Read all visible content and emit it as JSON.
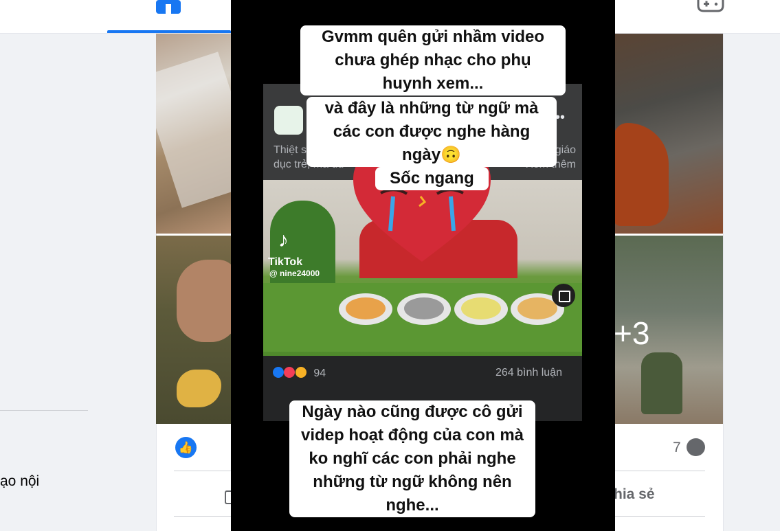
{
  "nav": {
    "active_tab": "home",
    "icons": {
      "home": "home-icon",
      "gaming": "gamepad-icon"
    },
    "accent": "#1877f2"
  },
  "sidebar": {
    "fragment_text": "ạo nội"
  },
  "post": {
    "photo_overflow": "+3",
    "comment_count": "7",
    "share_label": "hia sẻ"
  },
  "video": {
    "overlay_top": "Gvmm quên gửi nhầm video chưa ghép nhạc cho phụ huynh xem...",
    "overlay_mid": "và đây là những từ ngữ mà các con được nghe hàng ngày🙃",
    "overlay_shock": "Sốc ngang",
    "overlay_bottom": "Ngày nào cũng được cô gửi videp hoạt động của con mà ko nghĩ các con phải nghe những từ ngữ không nên nghe...",
    "embedded_post": {
      "caption_left": "Thiệt sự mình k",
      "caption_right": "rương giáo",
      "caption_line2_left": "dục trẻ, mà dù",
      "caption_line2_right": "Xem thêm",
      "reaction_count": "94",
      "comment_count": "264 bình luận",
      "reaction_colors": [
        "#1877f2",
        "#f33e58",
        "#f7b125"
      ]
    },
    "watermark": {
      "brand": "TikTok",
      "user": "@ nine24000"
    }
  }
}
